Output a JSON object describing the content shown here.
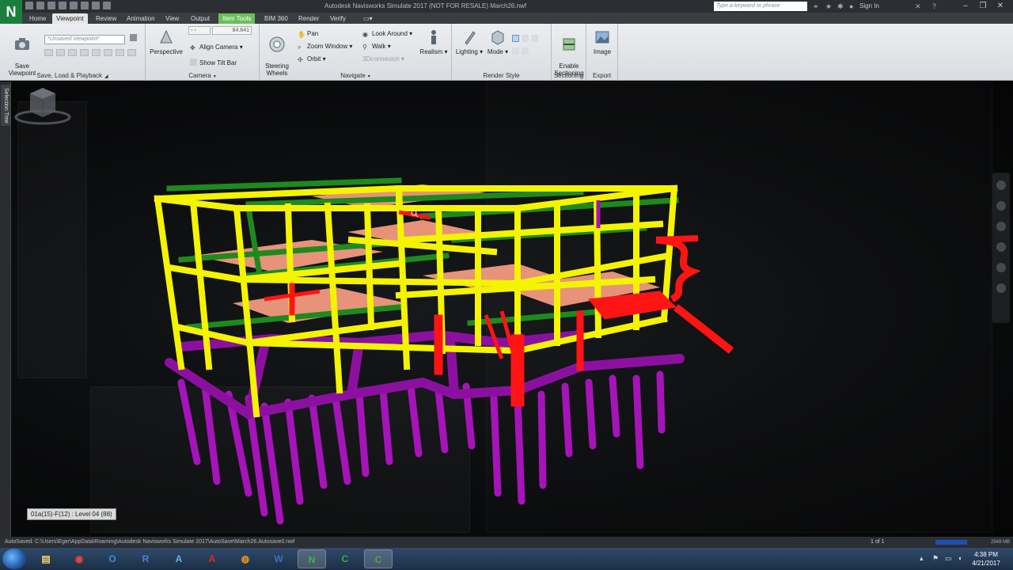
{
  "app": {
    "logo_letter": "N",
    "window_title": "Autodesk Navisworks Simulate 2017  (NOT FOR RESALE)    March26.nwf",
    "search_placeholder": "Type a keyword or phrase",
    "sign_in": "Sign In"
  },
  "tabs": [
    {
      "label": "Home"
    },
    {
      "label": "Viewpoint"
    },
    {
      "label": "Review"
    },
    {
      "label": "Animation"
    },
    {
      "label": "View"
    },
    {
      "label": "Output"
    },
    {
      "label": "Item Tools"
    },
    {
      "label": "BIM 360"
    },
    {
      "label": "Render"
    },
    {
      "label": "Verify"
    }
  ],
  "ribbon": {
    "save_load": {
      "save_viewpoint": "Save\nViewpoint",
      "viewpoint_combo": "*Unsaved Viewpoint*",
      "group_label": "Save, Load & Playback"
    },
    "camera": {
      "perspective": "Perspective",
      "fov_value": "84.841",
      "align_camera": "Align Camera",
      "show_tilt_bar": "Show Tilt Bar",
      "group_label": "Camera"
    },
    "navigate": {
      "steering_wheels": "Steering\nWheels",
      "pan": "Pan",
      "zoom_window": "Zoom Window",
      "orbit": "Orbit",
      "look_around": "Look Around",
      "walk": "Walk",
      "connexion": "3Dconnexion",
      "realism": "Realism",
      "group_label": "Navigate"
    },
    "render_style": {
      "lighting": "Lighting",
      "mode": "Mode",
      "group_label": "Render Style"
    },
    "sectioning": {
      "enable": "Enable\nSectioning",
      "group_label": "Sectioning"
    },
    "export": {
      "image": "Image",
      "group_label": "Export"
    }
  },
  "left_panel": {
    "tab_label": "Selection Tree"
  },
  "viewport": {
    "tooltip": "01a(15)-F(12) : Level 04 (88)"
  },
  "statusbar": {
    "autosave": "AutoSaved: C:\\Users\\Eger\\AppData\\Roaming\\Autodesk Navisworks Simulate 2017\\AutoSave\\March26.Autosave0.nwf",
    "pages": "1 of 1",
    "memory": "2549 MB"
  },
  "taskbar": {
    "time": "4:38 PM",
    "date": "4/21/2017",
    "apps": [
      "explorer",
      "chrome",
      "outlook",
      "revit",
      "autodesk",
      "acrobat",
      "firefox",
      "word",
      "navisworks",
      "camtasia",
      "camtasia-2"
    ]
  },
  "colors": {
    "beam_yellow": "#f4f400",
    "beam_green": "#1e8a1e",
    "slab_salmon": "#f29a80",
    "stair_red": "#ff1414",
    "pile_magenta": "#a514b8"
  }
}
